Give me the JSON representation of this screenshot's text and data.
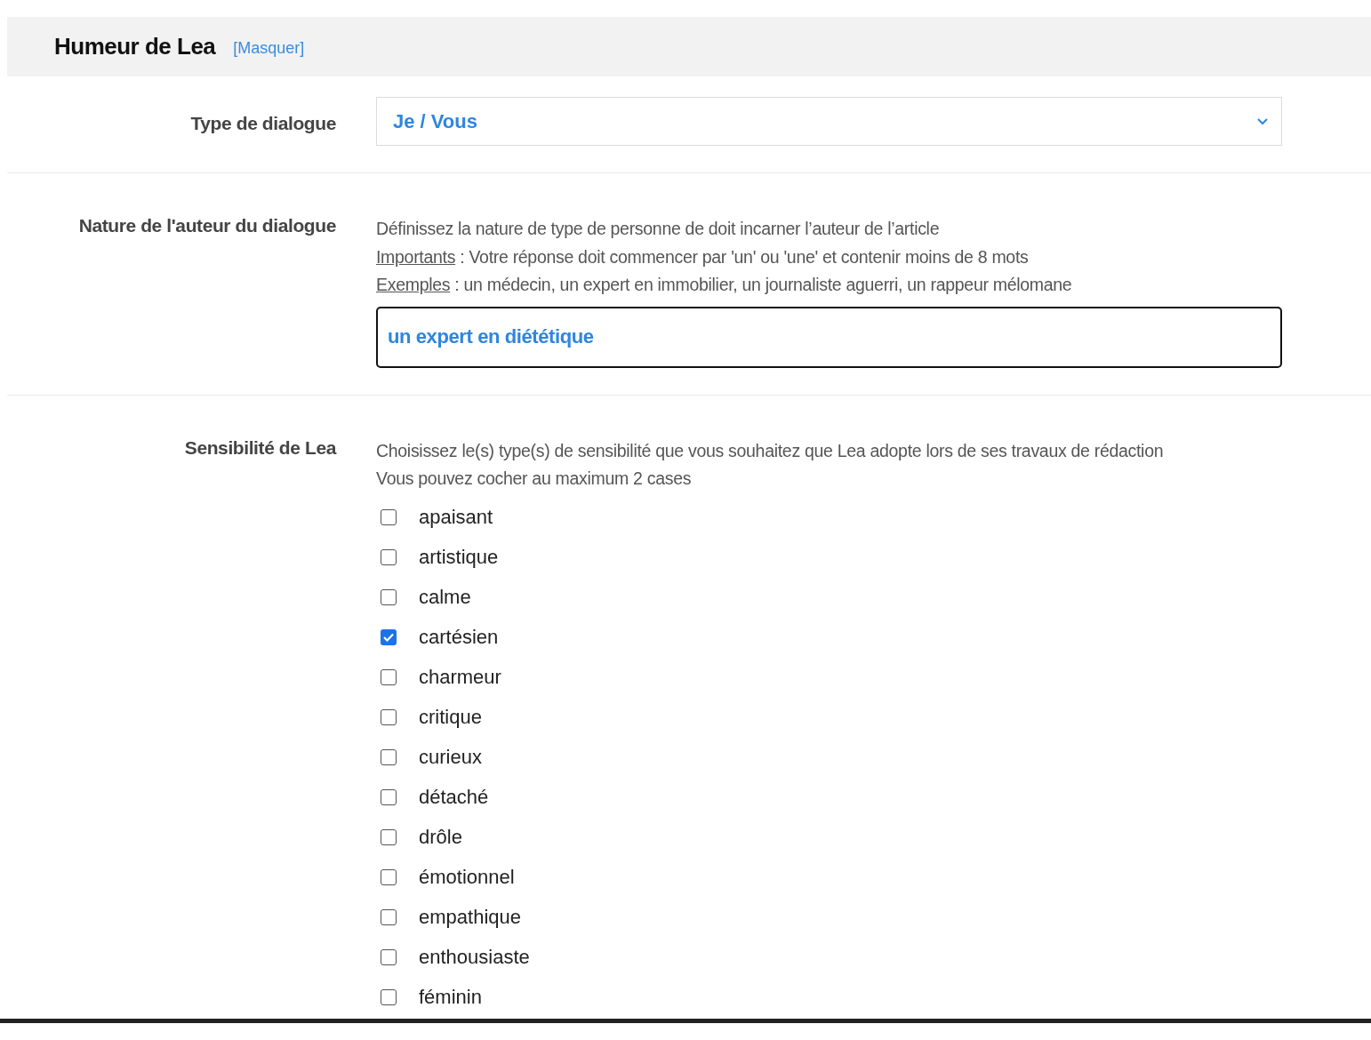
{
  "header": {
    "title": "Humeur de Lea",
    "toggle_link": "[Masquer]"
  },
  "dialogue_type": {
    "label": "Type de dialogue",
    "value": "Je / Vous"
  },
  "author_nature": {
    "label": "Nature de l'auteur du dialogue",
    "description": "Définissez la nature de type de personne de doit incarner l’auteur de l’article",
    "notes": [
      {
        "term": "Importants",
        "text": " : Votre réponse doit commencer par 'un' ou 'une' et contenir moins de 8 mots"
      },
      {
        "term": "Exemples",
        "text": " : un médecin, un expert en immobilier, un journaliste aguerri, un rappeur mélomane"
      }
    ],
    "value": "un expert en diététique"
  },
  "sensitivity": {
    "label": "Sensibilité de Lea",
    "description": "Choisissez le(s) type(s) de sensibilité que vous souhaitez que Lea adopte lors de ses travaux de rédaction",
    "hint": "Vous pouvez cocher au maximum 2 cases",
    "options": [
      {
        "label": "apaisant",
        "checked": false
      },
      {
        "label": "artistique",
        "checked": false
      },
      {
        "label": "calme",
        "checked": false
      },
      {
        "label": "cartésien",
        "checked": true
      },
      {
        "label": "charmeur",
        "checked": false
      },
      {
        "label": "critique",
        "checked": false
      },
      {
        "label": "curieux",
        "checked": false
      },
      {
        "label": "détaché",
        "checked": false
      },
      {
        "label": "drôle",
        "checked": false
      },
      {
        "label": "émotionnel",
        "checked": false
      },
      {
        "label": "empathique",
        "checked": false
      },
      {
        "label": "enthousiaste",
        "checked": false
      },
      {
        "label": "féminin",
        "checked": false
      }
    ]
  }
}
